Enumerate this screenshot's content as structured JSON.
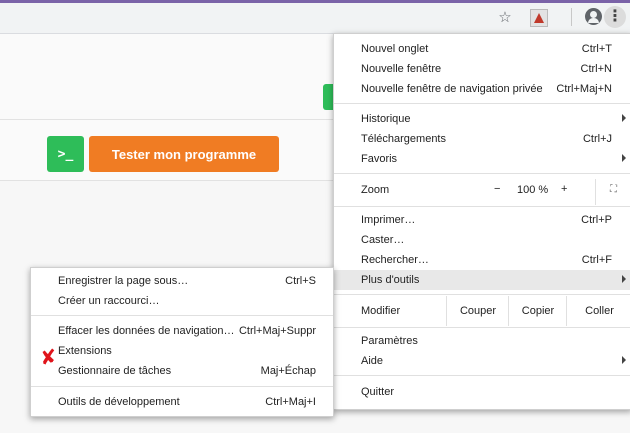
{
  "toolbar": {
    "star_icon": "☆",
    "kebab_icon": "⋮"
  },
  "page": {
    "terminal_icon": ">_",
    "run_button": "Tester mon programme"
  },
  "menu": {
    "items": [
      {
        "label": "Nouvel onglet",
        "shortcut": "Ctrl+T"
      },
      {
        "label": "Nouvelle fenêtre",
        "shortcut": "Ctrl+N"
      },
      {
        "label": "Nouvelle fenêtre de navigation privée",
        "shortcut": "Ctrl+Maj+N"
      },
      {
        "label": "Historique",
        "shortcut": ""
      },
      {
        "label": "Téléchargements",
        "shortcut": "Ctrl+J"
      },
      {
        "label": "Favoris",
        "shortcut": ""
      },
      {
        "label": "Imprimer…",
        "shortcut": "Ctrl+P"
      },
      {
        "label": "Caster…",
        "shortcut": ""
      },
      {
        "label": "Rechercher…",
        "shortcut": "Ctrl+F"
      },
      {
        "label": "Plus d'outils",
        "shortcut": ""
      },
      {
        "label": "Paramètres",
        "shortcut": ""
      },
      {
        "label": "Aide",
        "shortcut": ""
      },
      {
        "label": "Quitter",
        "shortcut": ""
      }
    ],
    "zoom": {
      "label": "Zoom",
      "minus": "−",
      "value": "100 %",
      "plus": "+",
      "fullscreen_icon": "⛶"
    },
    "edit": {
      "label": "Modifier",
      "cut": "Couper",
      "copy": "Copier",
      "paste": "Coller"
    }
  },
  "submenu": {
    "items": [
      {
        "label": "Enregistrer la page sous…",
        "shortcut": "Ctrl+S"
      },
      {
        "label": "Créer un raccourci…",
        "shortcut": ""
      },
      {
        "label": "Effacer les données de navigation…",
        "shortcut": "Ctrl+Maj+Suppr"
      },
      {
        "label": "Extensions",
        "shortcut": ""
      },
      {
        "label": "Gestionnaire de tâches",
        "shortcut": "Maj+Échap"
      },
      {
        "label": "Outils de développement",
        "shortcut": "Ctrl+Maj+I"
      }
    ],
    "annotation_mark": "✘"
  }
}
